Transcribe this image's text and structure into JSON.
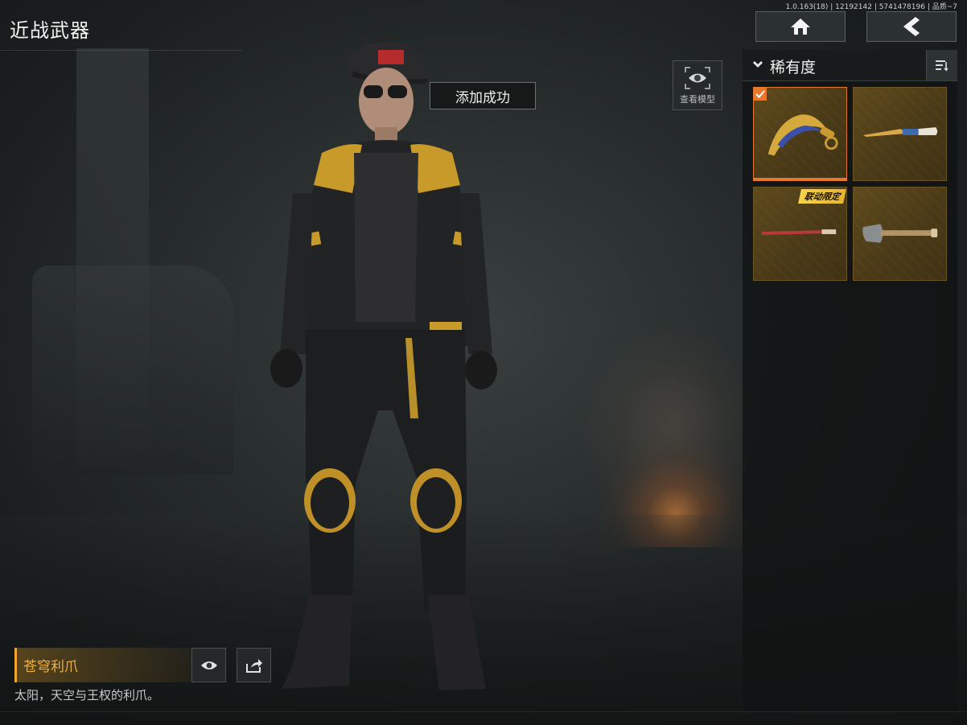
{
  "header": {
    "title": "近战武器",
    "version_info": "1.0.163(18) | 12192142 | 5741478196 | 品质~7",
    "home_icon": "home-icon",
    "back_icon": "back-arrow-icon"
  },
  "toast": {
    "message": "添加成功"
  },
  "view_model": {
    "label": "查看模型",
    "icon": "eye-icon"
  },
  "panel": {
    "sort_label": "稀有度",
    "sort_icon": "sort-list-icon",
    "items": [
      {
        "name": "karambit-claw",
        "selected": true,
        "badge": ""
      },
      {
        "name": "ornate-knife",
        "selected": false,
        "badge": ""
      },
      {
        "name": "red-blade",
        "selected": false,
        "badge": "联动限定"
      },
      {
        "name": "shovel",
        "selected": false,
        "badge": ""
      }
    ]
  },
  "selected_item": {
    "name": "苍穹利爪",
    "description": "太阳，天空与王权的利爪。",
    "preview_icon": "eye-icon",
    "share_icon": "share-icon"
  },
  "colors": {
    "accent": "#f2a72c",
    "selected_border": "#e7772a",
    "tile_gold": "#5e4a1c"
  }
}
